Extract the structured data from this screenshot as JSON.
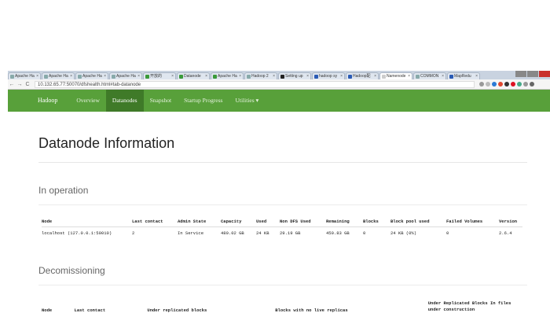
{
  "browser": {
    "tabs": [
      {
        "label": "Apache Ha"
      },
      {
        "label": "Apache Ha"
      },
      {
        "label": "Apache Ha"
      },
      {
        "label": "Apache Ha"
      },
      {
        "label": "开放的"
      },
      {
        "label": "Datanode"
      },
      {
        "label": "Apache Ha"
      },
      {
        "label": "Hadoop 2"
      },
      {
        "label": "Setting up"
      },
      {
        "label": "hadoop sy"
      },
      {
        "label": "Hadoop配"
      },
      {
        "label": "Namenode"
      },
      {
        "label": "COMMON"
      },
      {
        "label": "MapRedu"
      }
    ],
    "url": "10.132.65.77:50070/dfshealth.html#tab-datanode"
  },
  "navbar": {
    "brand": "Hadoop",
    "items": [
      {
        "label": "Overview"
      },
      {
        "label": "Datanodes"
      },
      {
        "label": "Snapshot"
      },
      {
        "label": "Startup Progress"
      },
      {
        "label": "Utilities ▾"
      }
    ]
  },
  "page": {
    "title": "Datanode Information",
    "in_operation": {
      "heading": "In operation",
      "columns": [
        "Node",
        "Last contact",
        "Admin State",
        "Capacity",
        "Used",
        "Non DFS Used",
        "Remaining",
        "Blocks",
        "Block pool used",
        "Failed Volumes",
        "Version"
      ],
      "rows": [
        [
          "localhost (127.0.0.1:50010)",
          "2",
          "In Service",
          "480.02 GB",
          "24 KB",
          "29.19 GB",
          "450.83 GB",
          "0",
          "24 KB (0%)",
          "0",
          "2.6.4"
        ]
      ]
    },
    "decommissioning": {
      "heading": "Decomissioning",
      "columns": [
        "Node",
        "Last contact",
        "Under replicated blocks",
        "Blocks with no live replicas",
        "Under Replicated Blocks In files under construction"
      ]
    }
  }
}
